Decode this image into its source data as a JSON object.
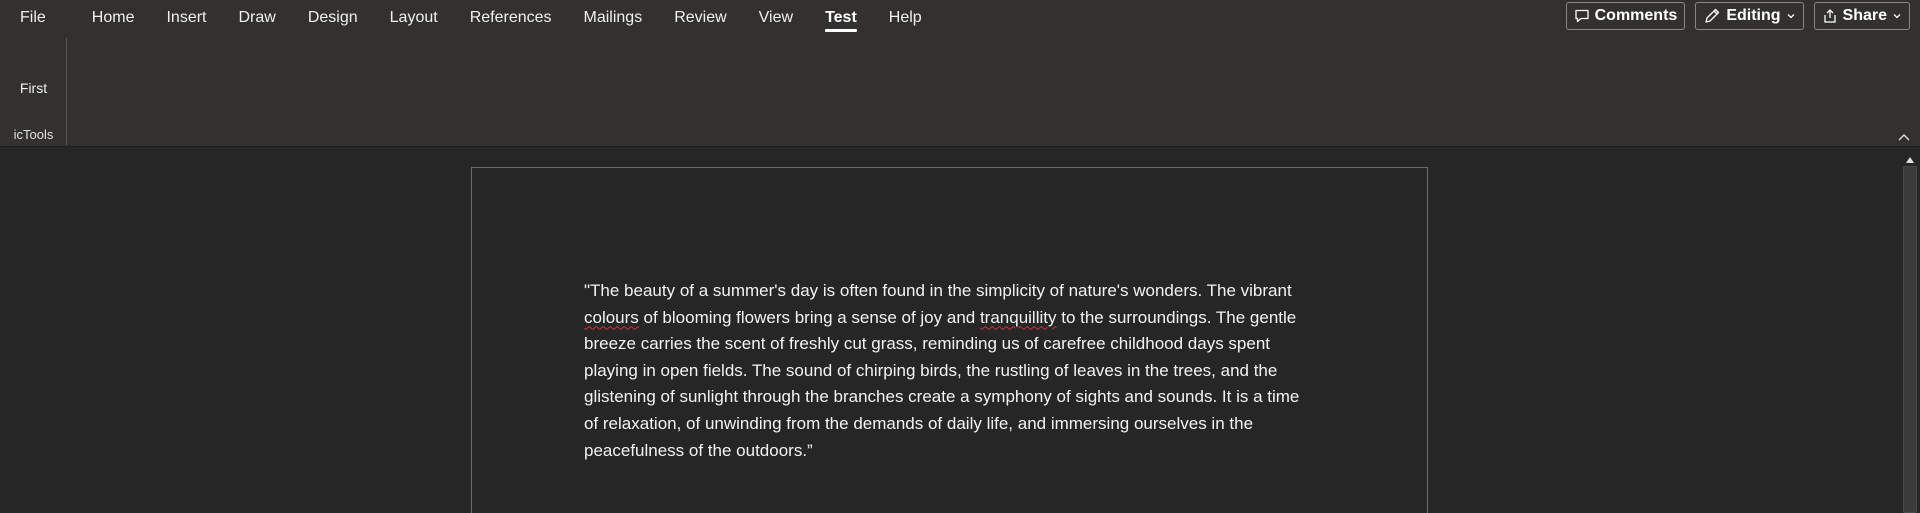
{
  "ribbon": {
    "tabs": [
      {
        "label": "File"
      },
      {
        "label": "Home"
      },
      {
        "label": "Insert"
      },
      {
        "label": "Draw"
      },
      {
        "label": "Design"
      },
      {
        "label": "Layout"
      },
      {
        "label": "References"
      },
      {
        "label": "Mailings"
      },
      {
        "label": "Review"
      },
      {
        "label": "View"
      },
      {
        "label": "Test",
        "active": true
      },
      {
        "label": "Help"
      }
    ],
    "actions": {
      "comments_label": "Comments",
      "editing_label": "Editing",
      "share_label": "Share"
    },
    "group": {
      "button_label": "First",
      "group_label": "icTools"
    }
  },
  "document": {
    "segments": {
      "s1": "\"The beauty of a summer's day is often found in the simplicity of nature's wonders. The vibrant ",
      "w1": "colours",
      "s2": " of blooming flowers bring a sense of joy and ",
      "w2": "tranquillity",
      "s3": " to the surroundings. The gentle breeze carries the scent of freshly cut grass, reminding us of carefree childhood days spent playing in open fields. The sound of chirping birds, the rustling of leaves in the trees, and the glistening of sunlight through the branches create a symphony of sights and sounds. It is a time of relaxation, of unwinding from the demands of daily life, and immersing ourselves in the peacefulness of the outdoors.”"
    }
  },
  "icons": {
    "comments": "comment-icon",
    "editing": "pencil-icon",
    "share": "share-icon",
    "dropdown": "chevron-down-icon",
    "collapse": "chevron-up-icon",
    "scroll_up": "triangle-up-icon"
  },
  "colors": {
    "ribbon_bg": "#323130",
    "canvas_bg": "#262626",
    "spell_error": "#d13438"
  }
}
